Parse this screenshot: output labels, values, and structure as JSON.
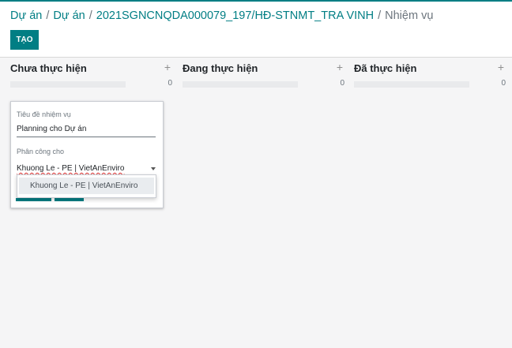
{
  "breadcrumb": {
    "items": [
      "Dự án",
      "Dự án",
      "2021SGNCNQDA000079_197/HĐ-STNMT_TRA VINH"
    ],
    "separator": "/",
    "current": "Nhiệm vụ"
  },
  "toolbar": {
    "create_label": "TẠO"
  },
  "columns": [
    {
      "title": "Chưa thực hiện",
      "add": "+",
      "count": "0"
    },
    {
      "title": "Đang thực hiện",
      "add": "+",
      "count": "0"
    },
    {
      "title": "Đã thực hiện",
      "add": "+",
      "count": "0"
    }
  ],
  "quick_create": {
    "title_label": "Tiêu đề nhiệm vụ",
    "title_value": "Planning cho Dự án",
    "assign_label": "Phân công cho",
    "assign_value": "Khuong Le - PE | VietAnEnviro"
  },
  "dropdown": {
    "options": [
      "Khuong Le - PE | VietAnEnviro"
    ]
  },
  "colors": {
    "accent": "#017e84",
    "background": "#f5f5f6"
  }
}
